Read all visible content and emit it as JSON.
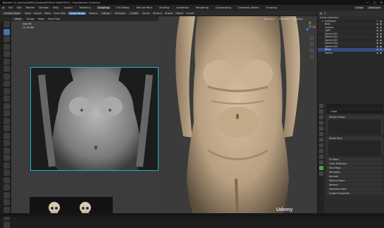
{
  "app": {
    "title": "Blender* [C:\\Users\\DANIEL\\Desktop\\FEMALE ANATOMY\\3 - Front\\female 03.blend]",
    "window_controls": [
      "—",
      "▢",
      "✕"
    ]
  },
  "menu": {
    "items": [
      "File",
      "Edit",
      "Render",
      "Window",
      "Help"
    ],
    "workspaces": [
      "Layout",
      "Modeling",
      "Sculpting",
      "UV Editing",
      "Texture Paint",
      "Shading",
      "Animation",
      "Rendering",
      "Compositing",
      "Geometry Nodes",
      "Scripting"
    ],
    "active_workspace": "Sculpting",
    "scene": "Scene",
    "view_layer": "ViewLayer"
  },
  "tool_header": {
    "mode": "Sculpt Mode",
    "view": "View",
    "sculpt": "Sculpt",
    "mask": "Mask",
    "face_sets": "Face Sets",
    "brush_label": "Draw Sharp",
    "radius_label": "Radius",
    "radius_value": "28 px",
    "strength_label": "Strength",
    "strength_value": "1.000",
    "direction": "Brush",
    "texture": "Texture",
    "stroke": "Stroke",
    "falloff": "Falloff",
    "cursor": "Cursor"
  },
  "left_view": {
    "header": [
      "View",
      "Sculpt",
      "Mask",
      "Face Sets"
    ],
    "label_line1": "Side Per",
    "label_line2": "(1) Sculpt"
  },
  "main_view": {
    "header": [
      "Dyntopo",
      "Remesh",
      "Options"
    ]
  },
  "outliner": {
    "search": "Scene Collection",
    "rows": [
      {
        "name": "Scene Collection",
        "sel": false
      },
      {
        "name": "Collection",
        "sel": false
      },
      {
        "name": "Body",
        "sel": false
      },
      {
        "name": "Camera",
        "sel": false
      },
      {
        "name": "Light",
        "sel": false
      },
      {
        "name": "Sphere.001",
        "sel": false
      },
      {
        "name": "Sphere.002",
        "sel": false
      },
      {
        "name": "Sphere.003",
        "sel": false
      },
      {
        "name": "Sphere.004",
        "sel": false
      },
      {
        "name": "Sphere.005",
        "sel": false
      },
      {
        "name": "Torso",
        "sel": true
      },
      {
        "name": "Sphere",
        "sel": false
      }
    ]
  },
  "properties": {
    "object": "Cube",
    "panels": [
      "Vertex Groups",
      "Shape Keys"
    ],
    "small_panels": [
      "UV Maps",
      "Color Attributes",
      "Face Maps",
      "Attributes",
      "Normals",
      "Texture Space",
      "Remesh",
      "Geometry Data",
      "Custom Properties"
    ]
  },
  "watermark": "Udemy",
  "colors": {
    "accent": "#4772b3",
    "selection_border": "#1fb2c6",
    "collection_orange": "#f0a030"
  }
}
